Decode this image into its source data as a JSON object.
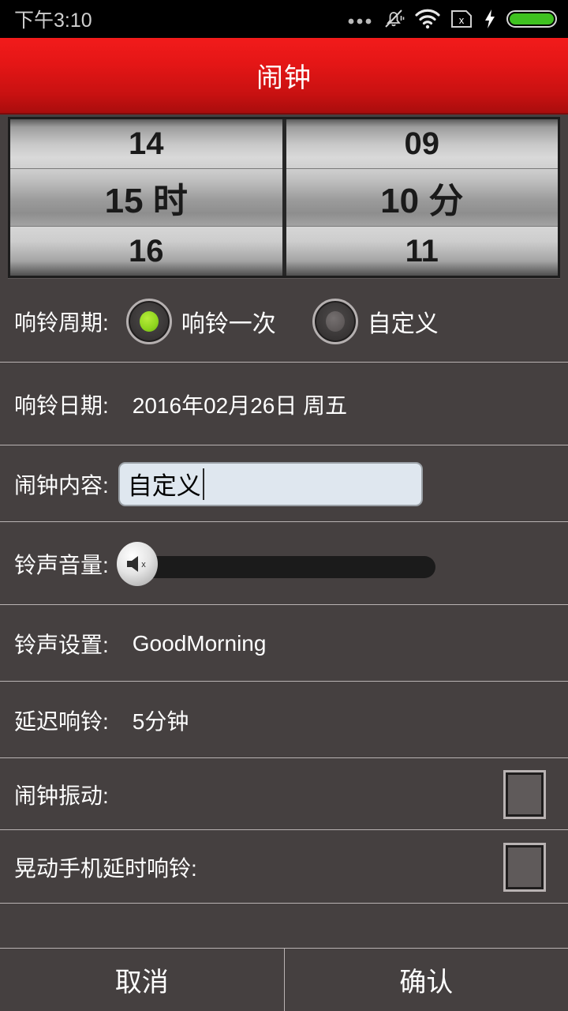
{
  "statusbar": {
    "clock": "下午3:10",
    "icons": [
      "more-dots-icon",
      "silent-bell-icon",
      "wifi-icon",
      "sim-x-icon",
      "charging-bolt-icon",
      "battery-icon"
    ]
  },
  "titlebar": {
    "title": "闹钟",
    "accent_color": "#e41616"
  },
  "picker": {
    "hour": {
      "prev": "14",
      "selected": "15 时",
      "next": "16"
    },
    "minute": {
      "prev": "09",
      "selected": "10 分",
      "next": "11"
    }
  },
  "rows": {
    "period": {
      "label": "响铃周期:",
      "options": [
        {
          "label": "响铃一次",
          "selected": true
        },
        {
          "label": "自定义",
          "selected": false
        }
      ],
      "selected_color": "#8ed41e"
    },
    "date": {
      "label": "响铃日期:",
      "value": "2016年02月26日 周五"
    },
    "content": {
      "label": "闹钟内容:",
      "value": "自定义",
      "placeholder": ""
    },
    "volume": {
      "label": "铃声音量:",
      "thumb_icon": "speaker-mute-icon",
      "level": 0
    },
    "ringtone": {
      "label": "铃声设置:",
      "value": "GoodMorning"
    },
    "snooze": {
      "label": "延迟响铃:",
      "value": "5分钟"
    },
    "vibrate": {
      "label": "闹钟振动:",
      "checked": false
    },
    "shake": {
      "label": "晃动手机延时响铃:",
      "checked": false
    }
  },
  "bottombar": {
    "cancel_label": "取消",
    "confirm_label": "确认"
  }
}
